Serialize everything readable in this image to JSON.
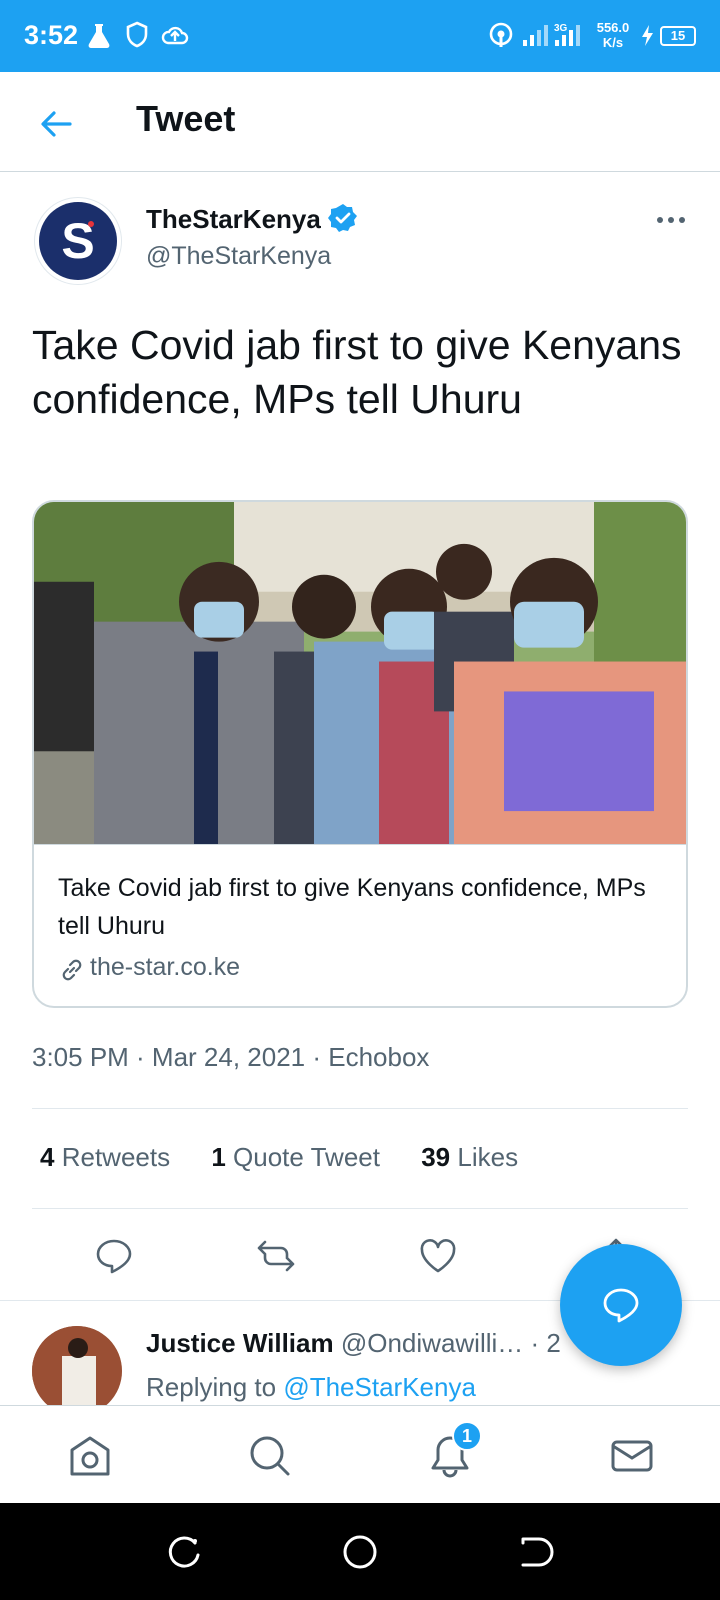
{
  "status_bar": {
    "time": "3:52",
    "network_speed_value": "556.0",
    "network_speed_unit": "K/s",
    "battery": "15",
    "background_color": "#1da1f2"
  },
  "header": {
    "back_icon": "arrow-left-icon",
    "title": "Tweet"
  },
  "tweet": {
    "author_name": "TheStarKenya",
    "author_handle": "@TheStarKenya",
    "verified": true,
    "text": "Take Covid jab first to give Kenyans confidence, MPs tell Uhuru",
    "card": {
      "title": "Take Covid jab first to give Kenyans confidence, MPs tell Uhuru",
      "domain": "the-star.co.ke"
    },
    "timestamp": "3:05 PM · Mar 24, 2021 · Echobox",
    "stats": [
      {
        "count": "4",
        "label": "Retweets"
      },
      {
        "count": "1",
        "label": "Quote Tweet"
      },
      {
        "count": "39",
        "label": "Likes"
      }
    ],
    "actions": [
      "reply-icon",
      "retweet-icon",
      "like-icon",
      "share-icon"
    ]
  },
  "reply": {
    "author_name": "Justice William",
    "author_handle": "@Ondiwawilli…",
    "time_fragment": "· 2",
    "replying_prefix": "Replying to",
    "replying_to": "@TheStarKenya"
  },
  "bottom_nav": {
    "items": [
      "home-icon",
      "search-icon",
      "notifications-icon",
      "messages-icon"
    ],
    "notification_badge": "1"
  },
  "colors": {
    "accent": "#1da1f2",
    "text_primary": "#0f1419",
    "text_secondary": "#536471",
    "border": "#cfd9de"
  }
}
